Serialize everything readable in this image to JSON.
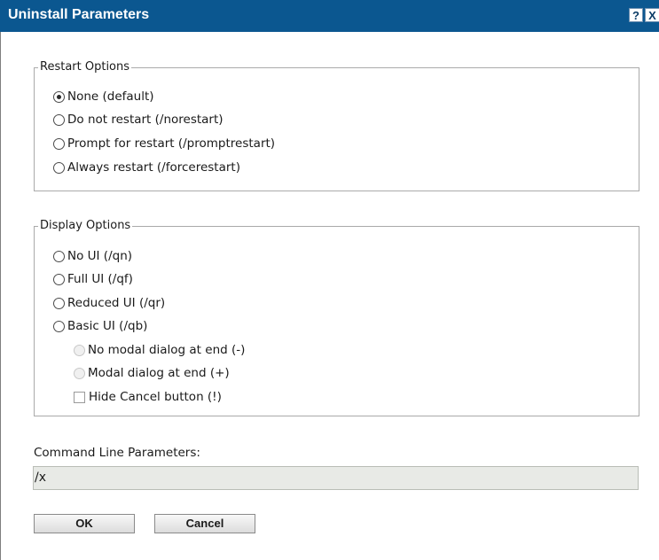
{
  "window": {
    "title": "Uninstall Parameters",
    "help_glyph": "?",
    "close_glyph": "X"
  },
  "restart_options": {
    "legend": "Restart Options",
    "items": [
      {
        "label": "None (default)",
        "checked": true
      },
      {
        "label": "Do not restart (/norestart)",
        "checked": false
      },
      {
        "label": "Prompt for restart (/promptrestart)",
        "checked": false
      },
      {
        "label": "Always restart (/forcerestart)",
        "checked": false
      }
    ]
  },
  "display_options": {
    "legend": "Display Options",
    "items": [
      {
        "label": "No UI (/qn)",
        "checked": false
      },
      {
        "label": "Full UI (/qf)",
        "checked": false
      },
      {
        "label": "Reduced UI (/qr)",
        "checked": false
      },
      {
        "label": "Basic UI (/qb)",
        "checked": false
      }
    ],
    "sub_items": [
      {
        "label": "No modal dialog at end (-)",
        "disabled": true
      },
      {
        "label": "Modal dialog at end (+)",
        "disabled": true
      }
    ],
    "hide_cancel_label": "Hide Cancel button (!)"
  },
  "command_line": {
    "label": "Command Line Parameters:",
    "value": "/x"
  },
  "buttons": {
    "ok_label": "OK",
    "cancel_label": "Cancel"
  },
  "colors": {
    "titlebar": "#0b5790",
    "input_bg": "#e8eae6"
  }
}
